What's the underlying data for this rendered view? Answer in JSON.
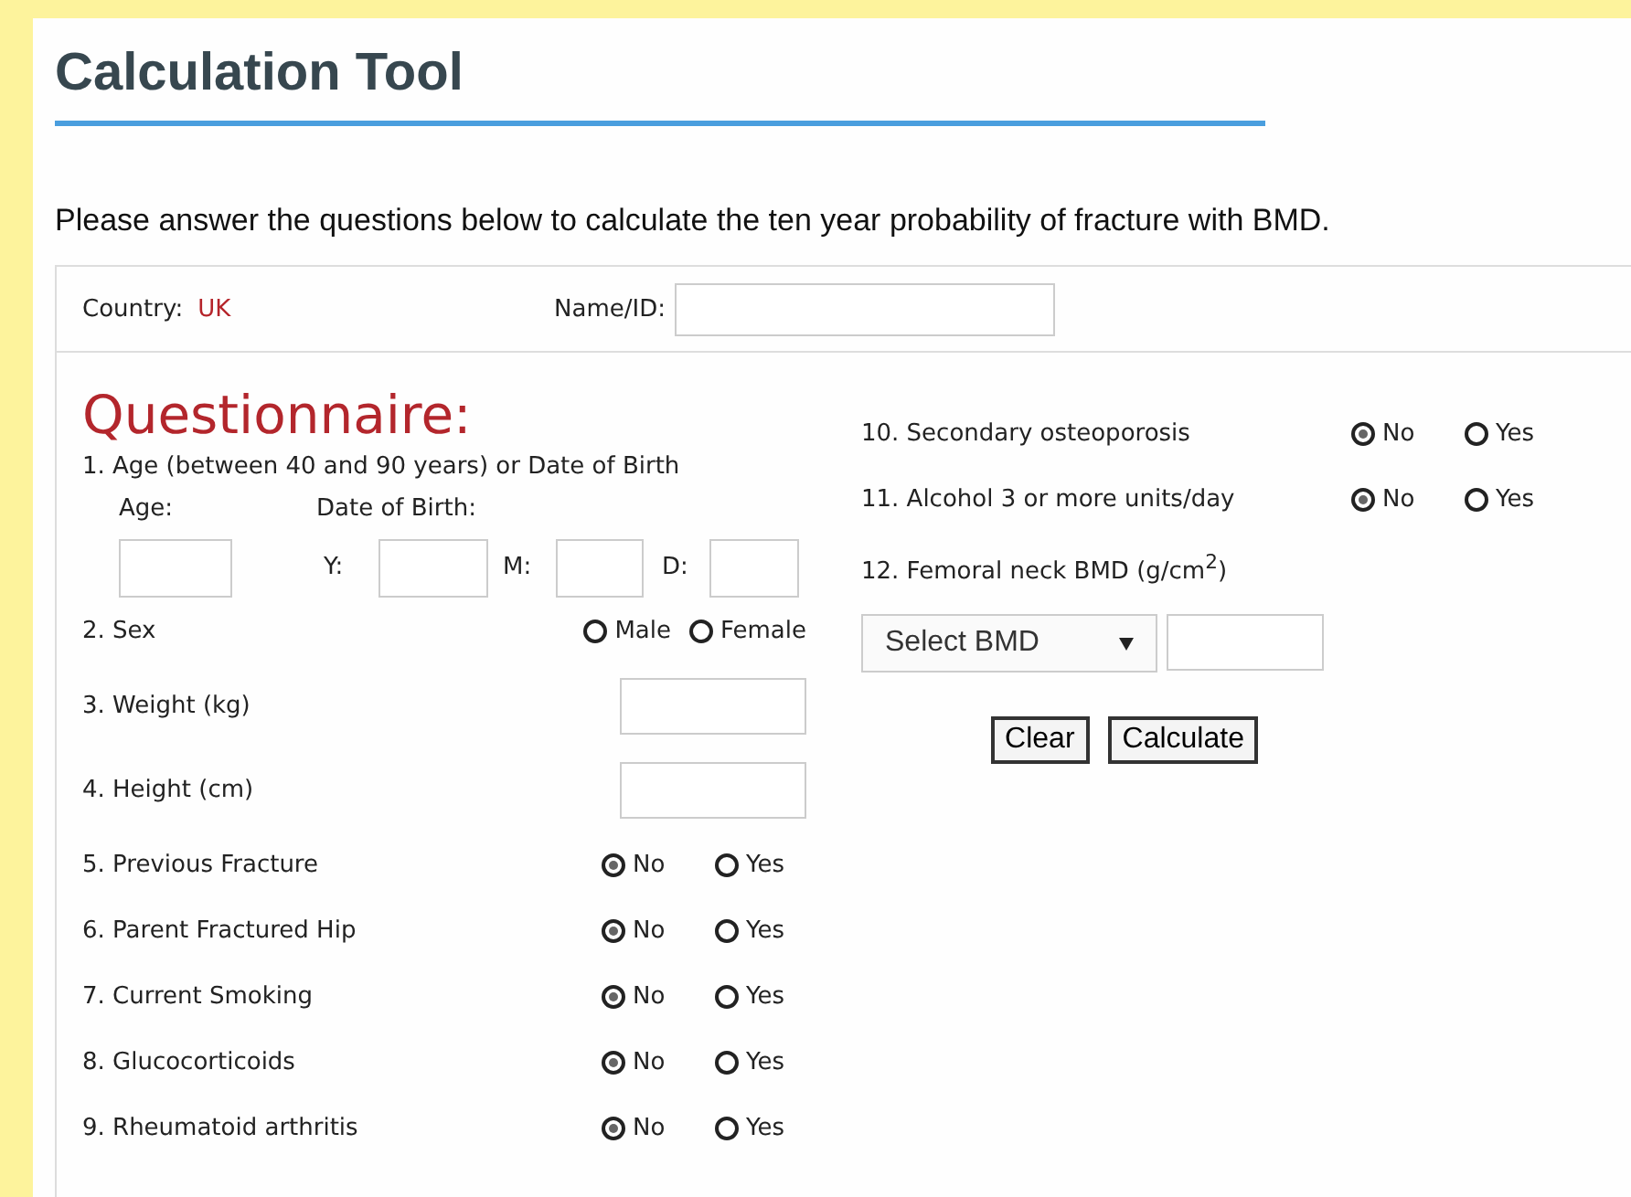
{
  "title": "Calculation Tool",
  "intro": "Please answer the questions below to calculate the ten year probability of fracture with BMD.",
  "country": {
    "label": "Country:",
    "value": "UK"
  },
  "name_id": {
    "label": "Name/ID:"
  },
  "heading": "Questionnaire:",
  "age": {
    "question": "1. Age (between 40 and 90 years) or Date of Birth",
    "age_label": "Age:",
    "dob_label": "Date of Birth:",
    "y_label": "Y:",
    "m_label": "M:",
    "d_label": "D:"
  },
  "left_questions": [
    {
      "kind": "radio",
      "label": "2. Sex",
      "options": [
        {
          "label": "Male",
          "selected": false
        },
        {
          "label": "Female",
          "selected": false
        }
      ]
    },
    {
      "kind": "field",
      "label": "3. Weight (kg)"
    },
    {
      "kind": "field",
      "label": "4. Height (cm)"
    },
    {
      "kind": "radio",
      "label": "5. Previous Fracture",
      "options": [
        {
          "label": "No",
          "selected": true
        },
        {
          "label": "Yes",
          "selected": false
        }
      ]
    },
    {
      "kind": "radio",
      "label": "6. Parent Fractured Hip",
      "options": [
        {
          "label": "No",
          "selected": true
        },
        {
          "label": "Yes",
          "selected": false
        }
      ]
    },
    {
      "kind": "radio",
      "label": "7. Current Smoking",
      "options": [
        {
          "label": "No",
          "selected": true
        },
        {
          "label": "Yes",
          "selected": false
        }
      ]
    },
    {
      "kind": "radio",
      "label": "8. Glucocorticoids",
      "options": [
        {
          "label": "No",
          "selected": true
        },
        {
          "label": "Yes",
          "selected": false
        }
      ]
    },
    {
      "kind": "radio",
      "label": "9. Rheumatoid arthritis",
      "options": [
        {
          "label": "No",
          "selected": true
        },
        {
          "label": "Yes",
          "selected": false
        }
      ]
    }
  ],
  "right_questions": [
    {
      "kind": "radio",
      "label": "10. Secondary osteoporosis",
      "options": [
        {
          "label": "No",
          "selected": true
        },
        {
          "label": "Yes",
          "selected": false
        }
      ]
    },
    {
      "kind": "radio",
      "label": "11. Alcohol 3 or more units/day",
      "options": [
        {
          "label": "No",
          "selected": true
        },
        {
          "label": "Yes",
          "selected": false
        }
      ]
    }
  ],
  "bmd": {
    "question": "12. Femoral neck BMD (g/cm$^{2}$)",
    "select": "Select BMD"
  },
  "buttons": [
    "Clear",
    "Calculate"
  ]
}
